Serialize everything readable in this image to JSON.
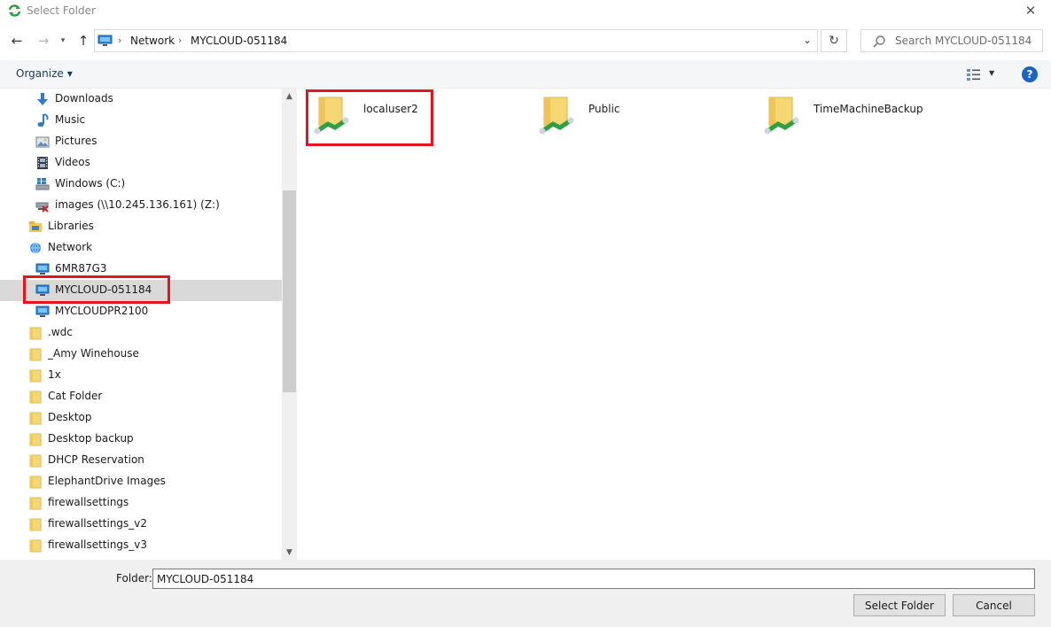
{
  "window": {
    "title": "Select Folder",
    "close_glyph": "✕"
  },
  "navigation": {
    "back_glyph": "←",
    "forward_glyph": "→",
    "recent_glyph": "▾",
    "up_glyph": "↑",
    "address": {
      "crumbs": [
        "Network",
        "MYCLOUD-051184"
      ],
      "separator": "›",
      "dropdown_glyph": "⌄"
    },
    "refresh_glyph": "↻",
    "search": {
      "placeholder": "Search MYCLOUD-051184"
    }
  },
  "commandbar": {
    "organize_label": "Organize",
    "caret": "▼",
    "view_caret": "▼",
    "help_glyph": "?"
  },
  "sidebar": {
    "items": [
      {
        "label": "Downloads",
        "icon": "download-icon"
      },
      {
        "label": "Music",
        "icon": "music-note-icon"
      },
      {
        "label": "Pictures",
        "icon": "pictures-icon"
      },
      {
        "label": "Videos",
        "icon": "video-film-icon"
      },
      {
        "label": "Windows (C:)",
        "icon": "windows-drive-icon"
      },
      {
        "label": "images (\\\\10.245.136.161) (Z:)",
        "icon": "disconnected-network-drive-icon"
      },
      {
        "label": "Libraries",
        "icon": "libraries-icon"
      },
      {
        "label": "Network",
        "icon": "network-icon"
      },
      {
        "label": "6MR87G3",
        "icon": "computer-icon"
      },
      {
        "label": "MYCLOUD-051184",
        "icon": "computer-icon",
        "selected": true
      },
      {
        "label": "MYCLOUDPR2100",
        "icon": "computer-icon"
      },
      {
        "label": ".wdc",
        "icon": "folder-icon"
      },
      {
        "label": "_Amy Winehouse",
        "icon": "folder-icon"
      },
      {
        "label": "1x",
        "icon": "folder-icon"
      },
      {
        "label": "Cat Folder",
        "icon": "folder-icon"
      },
      {
        "label": "Desktop",
        "icon": "folder-icon"
      },
      {
        "label": "Desktop backup",
        "icon": "folder-icon"
      },
      {
        "label": "DHCP Reservation",
        "icon": "folder-icon"
      },
      {
        "label": "ElephantDrive Images",
        "icon": "folder-icon"
      },
      {
        "label": "firewallsettings",
        "icon": "folder-icon"
      },
      {
        "label": "firewallsettings_v2",
        "icon": "folder-icon"
      },
      {
        "label": "firewallsettings_v3",
        "icon": "folder-icon"
      }
    ],
    "scroll_up_glyph": "▲",
    "scroll_down_glyph": "▼"
  },
  "content": {
    "items": [
      {
        "label": "localuser2",
        "icon": "shared-folder-icon"
      },
      {
        "label": "Public",
        "icon": "shared-folder-icon"
      },
      {
        "label": "TimeMachineBackup",
        "icon": "shared-folder-icon"
      }
    ]
  },
  "footer": {
    "folder_label": "Folder:",
    "folder_value": "MYCLOUD-051184",
    "select_button": "Select Folder",
    "cancel_button": "Cancel"
  },
  "colors": {
    "highlight": "#e5141d",
    "selected_row": "#d9d9d9",
    "help": "#1a63c7",
    "folder": "#f7d774"
  }
}
